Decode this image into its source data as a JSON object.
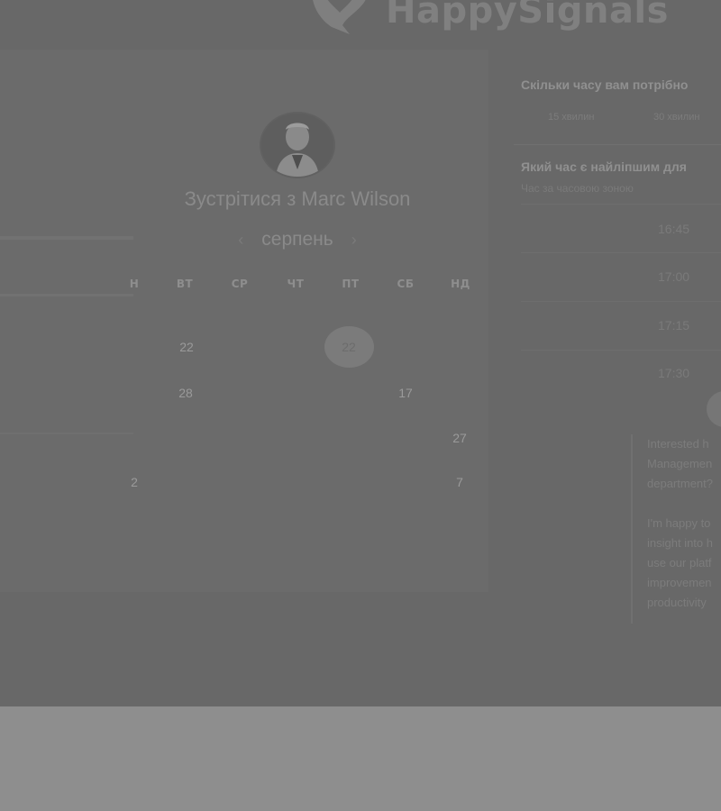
{
  "brand": {
    "name": "HappySignals"
  },
  "booking": {
    "title": "Зустрітися з Marc Wilson",
    "month": "серпень",
    "prev_label": "‹",
    "next_label": "›",
    "weekdays": [
      "Н",
      "ВТ",
      "СР",
      "ЧТ",
      "ПТ",
      "СБ",
      "НД"
    ],
    "days": {
      "row2": {
        "mon": "22",
        "fri_selected": "22"
      },
      "row3": {
        "mon": "28",
        "sat": "17"
      },
      "row4": {
        "sun": "27"
      },
      "row5": {
        "sun_prev": "2",
        "sun": "7"
      }
    }
  },
  "sidebar": {
    "question1": "Скільки часу вам потрібно",
    "durations": [
      "15 хвилин",
      "30 хвилин"
    ],
    "question2": "Який час є найліпшим для",
    "subtitle": "Час за часовою зоною",
    "times": [
      "16:45",
      "17:00",
      "17:15",
      "17:30"
    ],
    "promo_lines": [
      "Interested h",
      "Managemen",
      "department?",
      "",
      "I'm happy to",
      "insight into h",
      "use our platf",
      "improvemen",
      "productivity"
    ]
  },
  "colors": {
    "overlay": "#686868",
    "footer": "#8e8e8e"
  }
}
